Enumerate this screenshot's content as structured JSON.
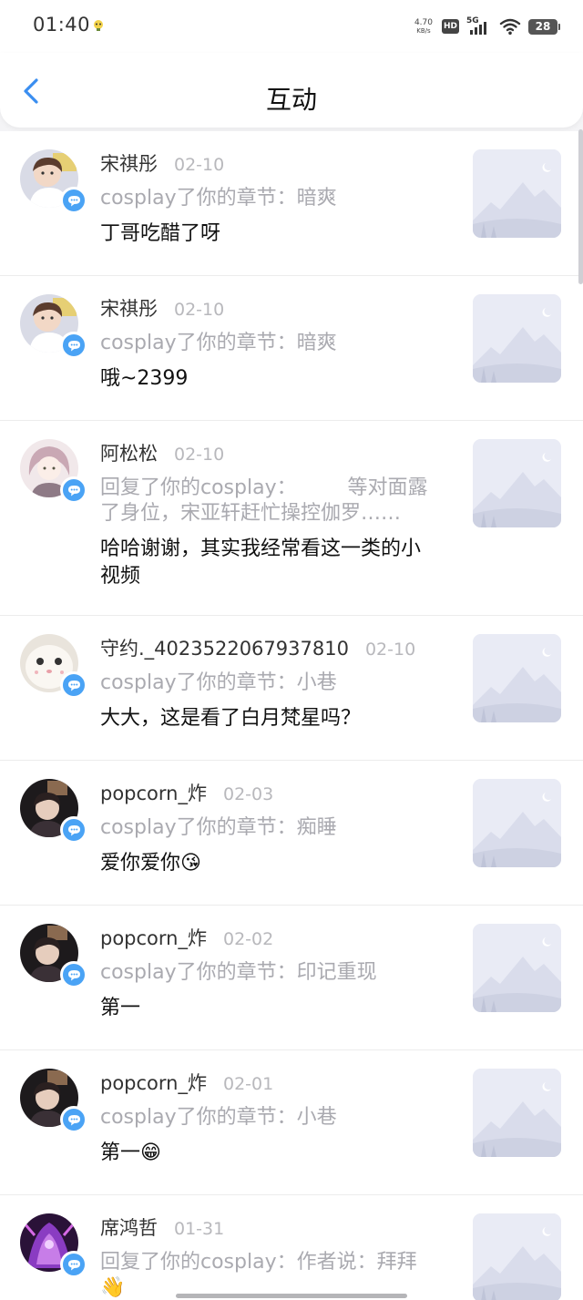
{
  "status_bar": {
    "time": "01:40",
    "net_speed_value": "4.70",
    "net_speed_unit": "KB/s",
    "hd_label": "HD",
    "network_label": "5G",
    "battery": "28"
  },
  "header": {
    "title": "互动",
    "back_icon": "chevron-left-icon"
  },
  "colors": {
    "accent": "#4aa3f5",
    "date_text": "#b8b8bc",
    "action_text": "#aaaab0",
    "thumbnail_bg": "#e9ebf5"
  },
  "notifications": [
    {
      "name": "宋祺彤",
      "date": "02-10",
      "action": "cosplay了你的章节：暗爽",
      "message": "丁哥吃醋了呀"
    },
    {
      "name": "宋祺彤",
      "date": "02-10",
      "action": "cosplay了你的章节：暗爽",
      "message": "哦~2399"
    },
    {
      "name": "阿松松",
      "date": "02-10",
      "action": "回复了你的cosplay：        等对面露了身位，宋亚轩赶忙操控伽罗……",
      "message": "哈哈谢谢，其实我经常看这一类的小视频"
    },
    {
      "name": "守约._4023522067937810",
      "date": "02-10",
      "action": "cosplay了你的章节：小巷",
      "message": "大大，这是看了白月梵星吗？"
    },
    {
      "name": "popcorn_炸",
      "date": "02-03",
      "action": "cosplay了你的章节：痴睡",
      "message": "爱你爱你😘"
    },
    {
      "name": "popcorn_炸",
      "date": "02-02",
      "action": "cosplay了你的章节：印记重现",
      "message": "第一"
    },
    {
      "name": "popcorn_炸",
      "date": "02-01",
      "action": "cosplay了你的章节：小巷",
      "message": "第一😁"
    },
    {
      "name": "席鸿哲",
      "date": "01-31",
      "action": "回复了你的cosplay：作者说：拜拜👋",
      "message": ""
    }
  ]
}
